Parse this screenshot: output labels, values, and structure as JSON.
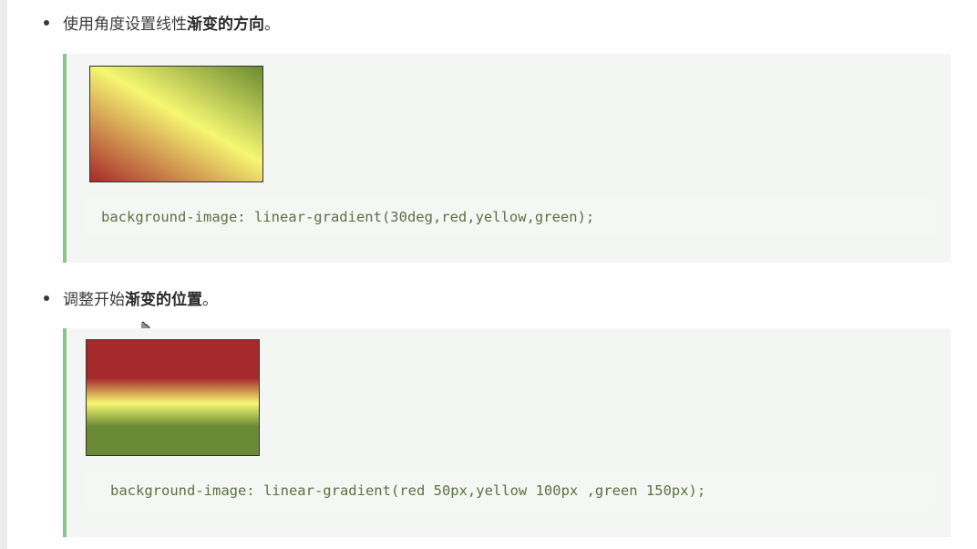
{
  "items": [
    {
      "text_plain": "使用角度设置线性",
      "text_bold": "渐变的方向",
      "text_tail": "。",
      "code": "background-image: linear-gradient(30deg,red,yellow,green);"
    },
    {
      "text_plain": "调整开始",
      "text_bold": "渐变的位置",
      "text_tail": "。",
      "code": "background-image: linear-gradient(red 50px,yellow 100px ,green 150px);"
    }
  ],
  "colors": {
    "red": "#a8292b",
    "yellow": "#f6f772",
    "green": "#6a8a30",
    "quote_border": "#8cc38c",
    "code_text": "#5f7040"
  },
  "icons": [
    "hand-cursor-icon"
  ]
}
